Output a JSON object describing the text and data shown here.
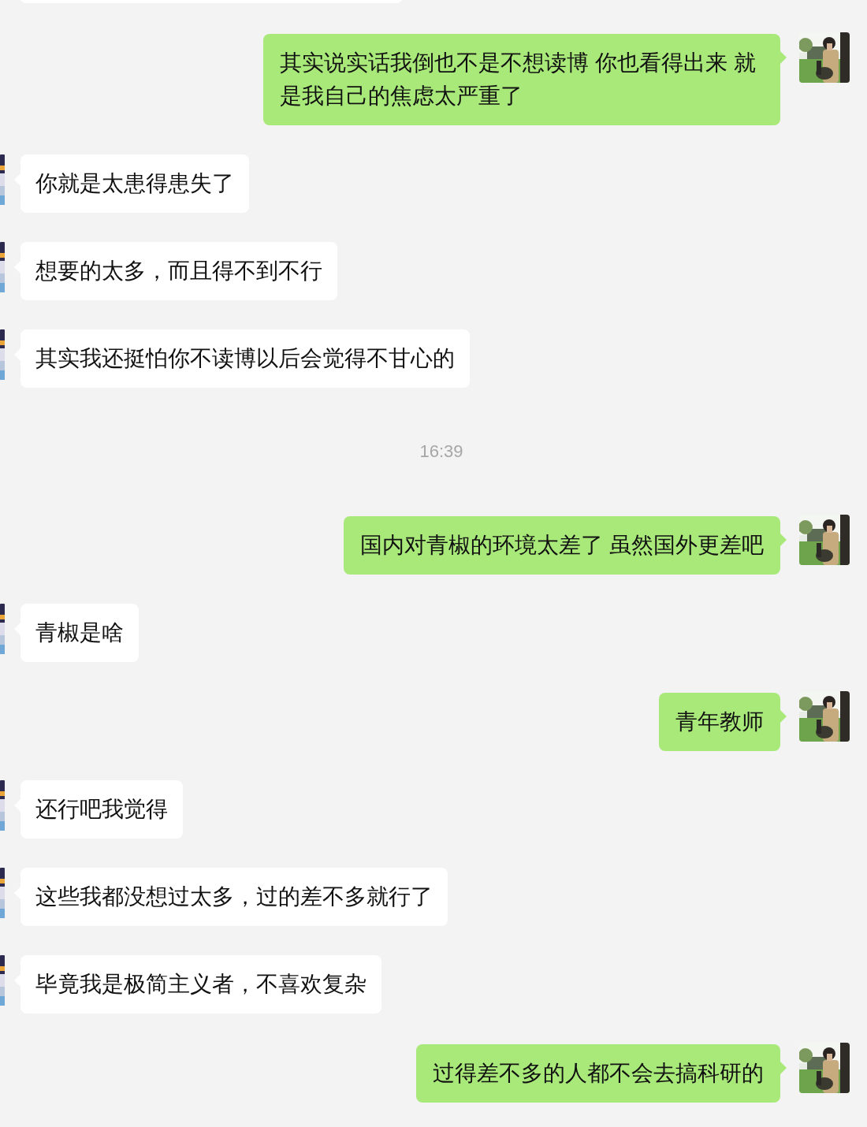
{
  "messages": [
    {
      "kind": "cut-off",
      "outgoing": false
    },
    {
      "kind": "text",
      "outgoing": true,
      "text": "其实说实话我倒也不是不想读博 你也看得出来 就是我自己的焦虑太严重了"
    },
    {
      "kind": "text",
      "outgoing": false,
      "text": "你就是太患得患失了"
    },
    {
      "kind": "text",
      "outgoing": false,
      "text": "想要的太多，而且得不到不行"
    },
    {
      "kind": "text",
      "outgoing": false,
      "text": "其实我还挺怕你不读博以后会觉得不甘心的"
    },
    {
      "kind": "time",
      "text": "16:39"
    },
    {
      "kind": "text",
      "outgoing": true,
      "text": "国内对青椒的环境太差了 虽然国外更差吧"
    },
    {
      "kind": "text",
      "outgoing": false,
      "text": "青椒是啥"
    },
    {
      "kind": "text",
      "outgoing": true,
      "text": "青年教师"
    },
    {
      "kind": "text",
      "outgoing": false,
      "text": "还行吧我觉得"
    },
    {
      "kind": "text",
      "outgoing": false,
      "text": "这些我都没想过太多，过的差不多就行了"
    },
    {
      "kind": "text",
      "outgoing": false,
      "text": "毕竟我是极简主义者，不喜欢复杂"
    },
    {
      "kind": "text",
      "outgoing": true,
      "text": "过得差不多的人都不会去搞科研的"
    }
  ]
}
